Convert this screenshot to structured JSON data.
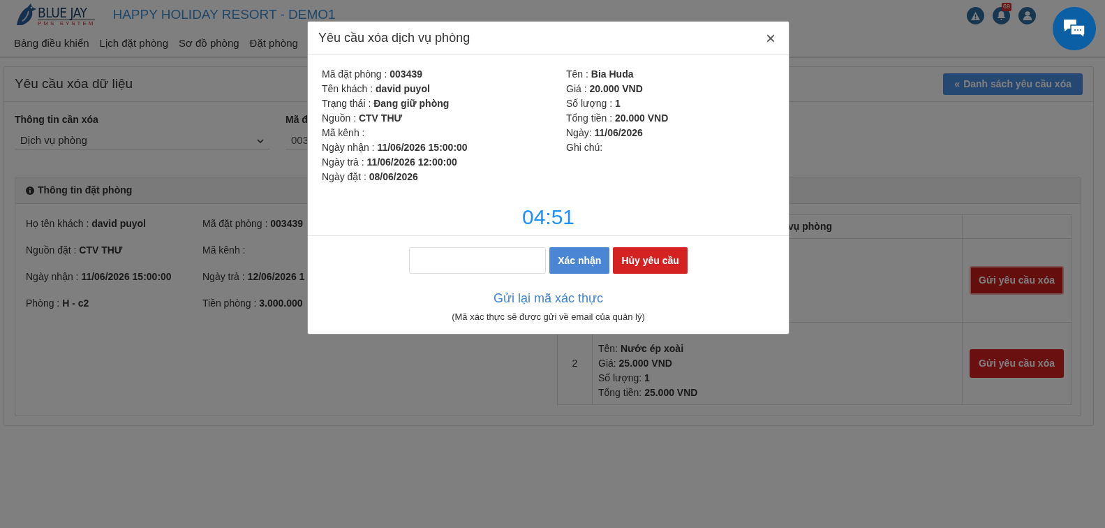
{
  "header": {
    "logo": {
      "title": "BLUE JAY",
      "subtitle": "PMS SYSTEM"
    },
    "hotel_name": "HAPPY HOLIDAY RESORT - DEMO1",
    "nav": [
      "Bảng điều khiển",
      "Lịch đặt phòng",
      "Sơ đồ phòng",
      "Đặt phòng"
    ],
    "notification_count": "69"
  },
  "page": {
    "title": "Yêu cầu xóa dữ liệu",
    "back_icon": "«",
    "back_button": "Danh sách yêu cầu xóa",
    "fields": [
      {
        "kind": "select",
        "label": "Thông tin cần xóa",
        "value": "Dịch vụ phòng"
      },
      {
        "kind": "text",
        "label": "Mã đ",
        "value": "003"
      }
    ],
    "booking_panel": {
      "title": "Thông tin đặt phòng",
      "info": [
        [
          "Họ tên khách : **david puyol**",
          "Mã đặt phòng : **003439**"
        ],
        [
          "Nguồn đặt : **CTV THƯ**",
          "Mã kênh :"
        ],
        [
          "Ngày nhận : **11/06/2026 15:00:00**",
          "Ngày trả : **12/06/2026 1**"
        ],
        [
          "Phòng : **H - c2**",
          "Tiền phòng : **3.000.000**"
        ]
      ]
    },
    "services_table": {
      "header": "vụ phòng",
      "rows": [
        {
          "number": "",
          "lines": [],
          "button": "Gửi yêu cầu xóa",
          "focused": true
        },
        {
          "number": "2",
          "lines": [
            "Tên: **Nước ép xoài**",
            "Giá: **25.000 VND**",
            "Số lượng: **1**",
            "Tổng tiền: **25.000 VND**"
          ],
          "button": "Gửi yêu cầu xóa",
          "focused": false
        }
      ]
    }
  },
  "modal": {
    "title": "Yêu cầu xóa dịch vụ phòng",
    "close": "×",
    "left": [
      "Mã đặt phòng : **003439**",
      "Tên khách : **david puyol**",
      "Trạng thái : **Đang giữ phòng**",
      "Nguồn : **CTV THƯ**",
      "Mã kênh :",
      "Ngày nhận : **11/06/2026 15:00:00**",
      "Ngày trả : **11/06/2026 12:00:00**",
      "Ngày đặt : **08/06/2026**"
    ],
    "right": [
      "Tên : **Bia Huda**",
      "Giá : **20.000 VND**",
      "Số lượng : **1**",
      "Tổng tiền : **20.000 VND**",
      "Ngày: **11/06/2026**",
      "Ghi chú:"
    ],
    "timer": "04:51",
    "confirm_button": "Xác nhận",
    "cancel_button": "Hủy yêu cầu",
    "resend_link": "Gửi lại mã xác thực",
    "resend_note": "(Mã xác thực sẽ được gửi về email của quản lý)"
  }
}
